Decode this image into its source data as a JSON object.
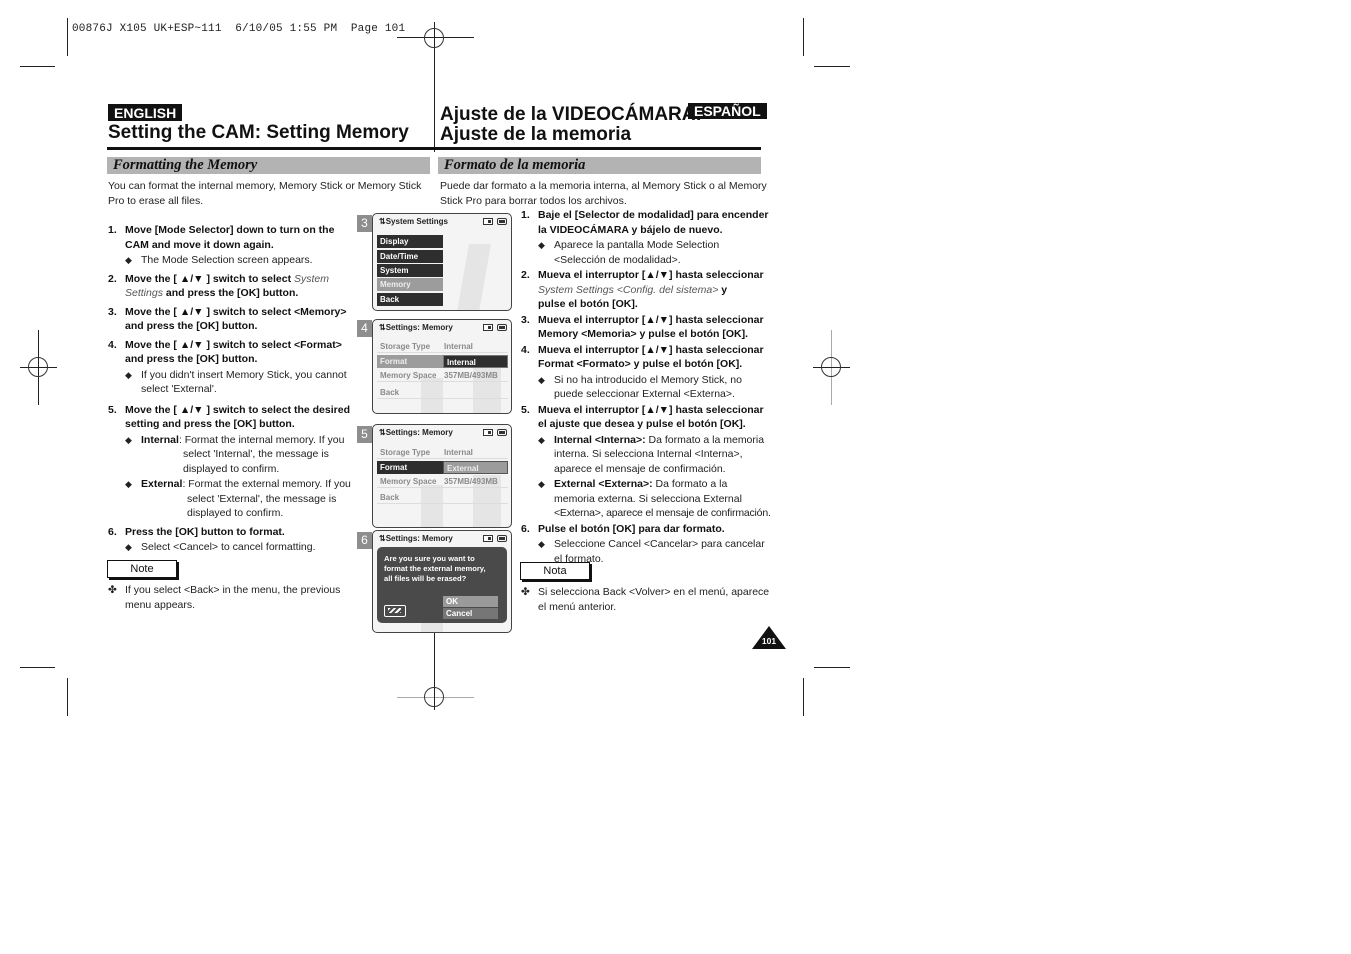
{
  "slug": "00876J X105 UK+ESP~111  6/10/05 1:55 PM  Page 101",
  "english": {
    "badge": "ENGLISH",
    "title": "Setting the CAM: Setting Memory",
    "section": "Formatting the Memory",
    "intro_1": "You can format the internal memory, Memory Stick or Memory Stick",
    "intro_2": "Pro to erase all files.",
    "steps": [
      {
        "num": "1.",
        "l1": "Move [Mode Selector] down to turn on the",
        "l2": "CAM and move it down again.",
        "sub": "The Mode Selection screen appears."
      },
      {
        "num": "2.",
        "l1a": "Move the [ ▲/▼ ] switch to select ",
        "l1b": "System",
        "l2a": "Settings",
        "l2b": " and press the [OK] button."
      },
      {
        "num": "3.",
        "l1": "Move the [ ▲/▼ ] switch to select <Memory>",
        "l2": "and press the [OK] button."
      },
      {
        "num": "4.",
        "l1": "Move the [ ▲/▼ ] switch to select <Format>",
        "l2": "and press the [OK] button.",
        "sub1": "If you didn't insert Memory Stick, you cannot",
        "sub2": "select 'External'."
      },
      {
        "num": "5.",
        "l1": "Move the [ ▲/▼ ] switch to select the desired",
        "l2": "setting and press the [OK] button.",
        "internal_label": "Internal",
        "internal_1": ": Format the internal memory. If you",
        "internal_2": "select 'Internal', the message is",
        "internal_3": "displayed to confirm.",
        "external_label": "External",
        "external_1": ": Format the external memory. If you",
        "external_2": "select 'External', the message is",
        "external_3": "displayed to confirm."
      },
      {
        "num": "6.",
        "l1": "Press the [OK] button to format.",
        "sub": "Select <Cancel> to cancel formatting."
      }
    ],
    "note_label": "Note",
    "note_1": "If you select <Back> in the menu, the previous",
    "note_2": "menu appears."
  },
  "spanish": {
    "badge": "ESPAÑOL",
    "title_1": "Ajuste de la VIDEOCÁMARA:",
    "title_2": "Ajuste de la memoria",
    "section": "Formato de la memoria",
    "intro_1": "Puede dar formato a la memoria interna, al Memory Stick o al Memory",
    "intro_2": "Stick Pro para borrar todos los archivos.",
    "steps": [
      {
        "num": "1.",
        "l1": "Baje el [Selector de modalidad] para encender",
        "l2": "la VIDEOCÁMARA y bájelo de nuevo.",
        "sub1": "Aparece la pantalla Mode Selection",
        "sub2": "<Selección de modalidad>."
      },
      {
        "num": "2.",
        "l1": "Mueva el interruptor [▲/▼] hasta seleccionar",
        "l2a": "System Settings <Config. del sistema>",
        "l2b": " y",
        "l3": "pulse el botón [OK]."
      },
      {
        "num": "3.",
        "l1": "Mueva el interruptor [▲/▼] hasta seleccionar",
        "l2": "Memory <Memoria> y pulse el botón [OK]."
      },
      {
        "num": "4.",
        "l1": "Mueva el interruptor [▲/▼] hasta seleccionar",
        "l2": "Format <Formato> y pulse el botón [OK].",
        "sub1": "Si no ha introducido el Memory Stick, no",
        "sub2": "puede seleccionar External <Externa>."
      },
      {
        "num": "5.",
        "l1": "Mueva el interruptor [▲/▼] hasta seleccionar",
        "l2": "el ajuste que desea y pulse el botón [OK].",
        "internal_label": "Internal <Interna>:",
        "internal_1": " Da formato a la memoria",
        "internal_2": "interna.  Si selecciona Internal <Interna>,",
        "internal_3": "aparece el mensaje de confirmación.",
        "external_label": "External <Externa>:",
        "external_1": " Da formato a la",
        "external_2": "memoria externa.  Si selecciona External",
        "external_3": "<Externa>, aparece el mensaje de confirmación."
      },
      {
        "num": "6.",
        "l1": "Pulse el botón [OK] para dar formato.",
        "sub1": "Seleccione Cancel <Cancelar> para cancelar",
        "sub2": "el formato."
      }
    ],
    "note_label": "Nota",
    "note_1": "Si selecciona Back <Volver> en el menú, aparece",
    "note_2": "el menú anterior."
  },
  "screens": [
    {
      "num": "3",
      "header": "System Settings",
      "menu": [
        "Display",
        "Date/Time",
        "System",
        "Memory",
        "Back"
      ],
      "selected": "Memory"
    },
    {
      "num": "4",
      "header": "Settings: Memory",
      "rows": [
        {
          "key": "Storage Type",
          "value": "Internal"
        },
        {
          "key": "Format",
          "value": "Internal"
        },
        {
          "key": "Memory Space",
          "value": "357MB/493MB"
        },
        {
          "key": "Back",
          "value": ""
        }
      ]
    },
    {
      "num": "5",
      "header": "Settings: Memory",
      "rows": [
        {
          "key": "Storage Type",
          "value": "Internal"
        },
        {
          "key": "Format",
          "value": "External"
        },
        {
          "key": "Memory Space",
          "value": "357MB/493MB"
        },
        {
          "key": "Back",
          "value": ""
        }
      ]
    },
    {
      "num": "6",
      "header": "Settings: Memory",
      "dialog": {
        "msg_1": "Are you sure you want to",
        "msg_2": "format the external memory,",
        "msg_3": "all files will be erased?",
        "ok": "OK",
        "cancel": "Cancel"
      }
    }
  ],
  "bullet_diamond": "◆",
  "bullet_cross": "✤",
  "page_number": "101",
  "icons": {
    "settings": "settings-icon",
    "card": "memory-card-icon",
    "battery": "battery-icon",
    "format": "format-memory-icon"
  }
}
